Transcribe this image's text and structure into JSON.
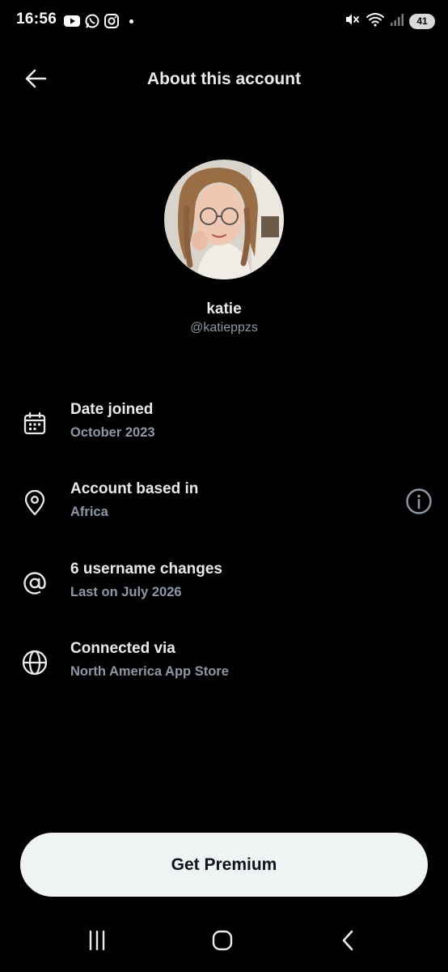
{
  "status_bar": {
    "time": "16:56",
    "app_icons": [
      "youtube-icon",
      "whatsapp-icon",
      "instagram-icon"
    ],
    "battery": "41"
  },
  "header": {
    "title": "About this account"
  },
  "profile": {
    "name": "katie",
    "handle": "@katieppzs"
  },
  "info": [
    {
      "icon": "calendar-icon",
      "title": "Date joined",
      "subtitle": "October 2023"
    },
    {
      "icon": "location-pin-icon",
      "title": "Account based in",
      "subtitle": "Africa"
    },
    {
      "icon": "at-sign-icon",
      "title": "6 username changes",
      "subtitle": "Last on July 2026"
    },
    {
      "icon": "globe-icon",
      "title": "Connected via",
      "subtitle": "North America App Store"
    }
  ],
  "premium_button": {
    "label": "Get Premium"
  },
  "colors": {
    "background": "#000000",
    "primary_text": "#e7e9ea",
    "secondary_text": "#8b98a5",
    "button_bg": "#eff3f4",
    "button_text": "#0f1419"
  }
}
